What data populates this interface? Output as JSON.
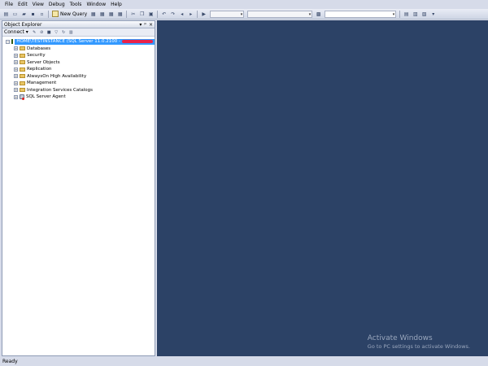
{
  "menu": [
    "File",
    "Edit",
    "View",
    "Debug",
    "Tools",
    "Window",
    "Help"
  ],
  "toolbar": {
    "new_query_label": "New Query"
  },
  "object_explorer": {
    "title": "Object Explorer",
    "title_actions": [
      "▾",
      "ᵖ",
      "×"
    ],
    "connect_label": "Connect ▾",
    "server_label": "HOME\\TESTINSTANCE (SQL Server 11.0.2100 -",
    "nodes": [
      {
        "label": "Databases",
        "icon": "folder-icon"
      },
      {
        "label": "Security",
        "icon": "folder-icon"
      },
      {
        "label": "Server Objects",
        "icon": "folder-icon"
      },
      {
        "label": "Replication",
        "icon": "folder-icon"
      },
      {
        "label": "AlwaysOn High Availability",
        "icon": "folder-icon"
      },
      {
        "label": "Management",
        "icon": "folder-icon"
      },
      {
        "label": "Integration Services Catalogs",
        "icon": "folder-icon"
      },
      {
        "label": "SQL Server Agent",
        "icon": "agent-icon"
      }
    ]
  },
  "watermark": {
    "title": "Activate Windows",
    "subtitle": "Go to PC settings to activate Windows."
  },
  "status": {
    "text": "Ready"
  },
  "colors": {
    "workspace": "#2c4266",
    "selection": "#3399ff"
  }
}
